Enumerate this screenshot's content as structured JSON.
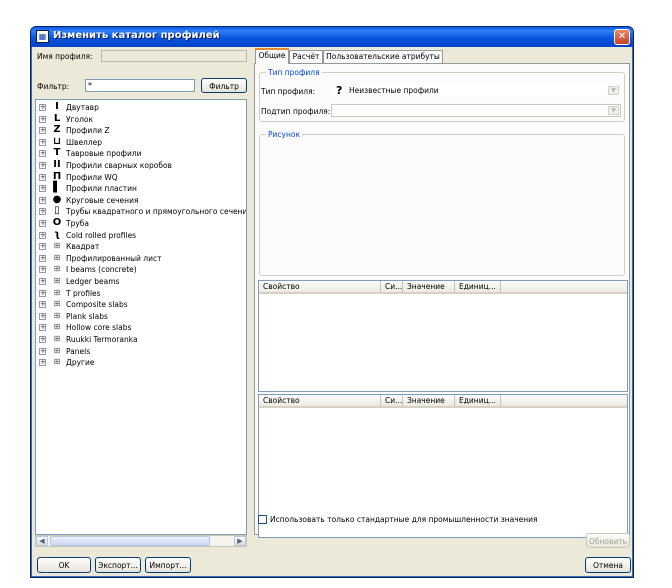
{
  "window": {
    "title": "Изменить каталог профилей",
    "icon": "catalog-icon",
    "title_color": "#0a58e6"
  },
  "left": {
    "profile_name_label": "Имя профиля:",
    "profile_name_value": "",
    "filter_label": "Фильтр:",
    "filter_value": "*",
    "filter_button": "Фильтр",
    "tree": [
      {
        "label": "Двутавр",
        "icon": "I-beam-icon"
      },
      {
        "label": "Уголок",
        "icon": "angle-icon"
      },
      {
        "label": "Профили Z",
        "icon": "z-profile-icon"
      },
      {
        "label": "Швеллер",
        "icon": "channel-icon"
      },
      {
        "label": "Тавровые профили",
        "icon": "tee-icon"
      },
      {
        "label": "Профили сварных коробов",
        "icon": "welded-box-icon"
      },
      {
        "label": "Профили WQ",
        "icon": "wq-profile-icon"
      },
      {
        "label": "Профили пластин",
        "icon": "plate-icon"
      },
      {
        "label": "Круговые сечения",
        "icon": "round-bar-icon"
      },
      {
        "label": "Трубы квадратного и прямоугольного сечени",
        "icon": "rect-tube-icon"
      },
      {
        "label": "Труба",
        "icon": "pipe-icon"
      },
      {
        "label": "Cold rolled profiles",
        "icon": "cold-rolled-icon"
      },
      {
        "label": "Квадрат",
        "icon": "parametric-icon"
      },
      {
        "label": "Профилированный лист",
        "icon": "parametric-icon"
      },
      {
        "label": "I beams (concrete)",
        "icon": "parametric-icon"
      },
      {
        "label": "Ledger beams",
        "icon": "parametric-icon"
      },
      {
        "label": "T profiles",
        "icon": "parametric-icon"
      },
      {
        "label": "Composite slabs",
        "icon": "parametric-icon"
      },
      {
        "label": "Plank slabs",
        "icon": "parametric-icon"
      },
      {
        "label": "Hollow core slabs",
        "icon": "parametric-icon"
      },
      {
        "label": "Ruukki Termoranka",
        "icon": "parametric-icon"
      },
      {
        "label": "Panels",
        "icon": "parametric-icon"
      },
      {
        "label": "Другие",
        "icon": "parametric-icon"
      }
    ]
  },
  "tabs": [
    "Общие",
    "Расчёт",
    "Пользовательские атрибуты"
  ],
  "general": {
    "profile_type_group": "Тип профиля",
    "profile_type_label": "Тип профиля:",
    "profile_type_icon": "question-icon",
    "profile_type_value": "Неизвестные профили",
    "subtype_label": "Подтип профиля:",
    "subtype_value": "",
    "picture_group": "Рисунок",
    "grid_columns": [
      "Свойство",
      "Си...",
      "Значение",
      "Единиц..."
    ],
    "std_values_label": "Использовать только стандартные для промышленности значения",
    "update_button": "Обновить"
  },
  "footer": {
    "ok": "OK",
    "export": "Экспорт...",
    "import": "Импорт...",
    "cancel": "Отмена"
  }
}
